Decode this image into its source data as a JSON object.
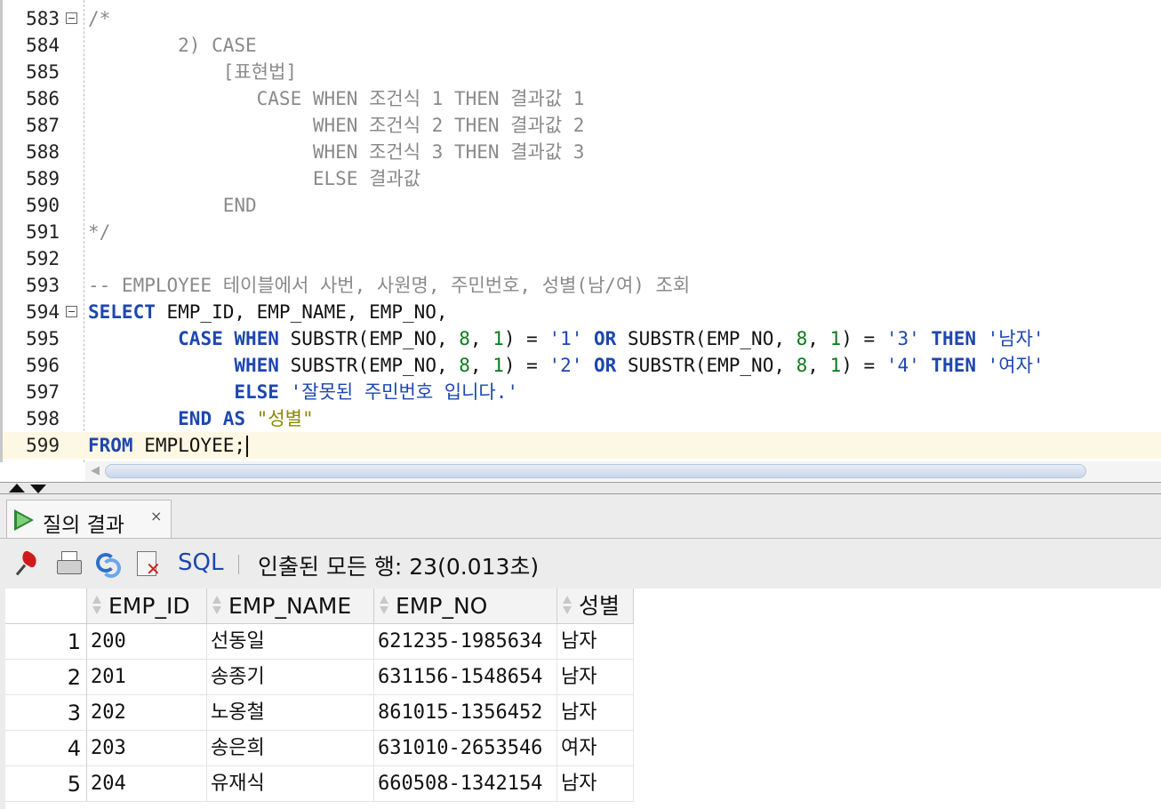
{
  "editor": {
    "lines": [
      {
        "num": "583",
        "fold": true,
        "segments": [
          {
            "t": "/*",
            "c": "com"
          }
        ]
      },
      {
        "num": "584",
        "segments": [
          {
            "t": "        2) CASE",
            "c": "com"
          }
        ]
      },
      {
        "num": "585",
        "segments": [
          {
            "t": "            [표현법]",
            "c": "com"
          }
        ]
      },
      {
        "num": "586",
        "segments": [
          {
            "t": "               CASE WHEN 조건식 1 THEN 결과값 1",
            "c": "com"
          }
        ]
      },
      {
        "num": "587",
        "segments": [
          {
            "t": "                    WHEN 조건식 2 THEN 결과값 2",
            "c": "com"
          }
        ]
      },
      {
        "num": "588",
        "segments": [
          {
            "t": "                    WHEN 조건식 3 THEN 결과값 3",
            "c": "com"
          }
        ]
      },
      {
        "num": "589",
        "segments": [
          {
            "t": "                    ELSE 결과값",
            "c": "com"
          }
        ]
      },
      {
        "num": "590",
        "segments": [
          {
            "t": "            END",
            "c": "com"
          }
        ]
      },
      {
        "num": "591",
        "segments": [
          {
            "t": "*/",
            "c": "com"
          }
        ]
      },
      {
        "num": "592",
        "segments": []
      },
      {
        "num": "593",
        "segments": [
          {
            "t": "-- EMPLOYEE 테이블에서 사번, 사원명, 주민번호, 성별(남/여) 조회",
            "c": "com"
          }
        ]
      },
      {
        "num": "594",
        "fold": true,
        "segments": [
          {
            "t": "SELECT",
            "c": "kw"
          },
          {
            "t": " EMP_ID, EMP_NAME, EMP_NO,",
            "c": "id"
          }
        ]
      },
      {
        "num": "595",
        "segments": [
          {
            "t": "        ",
            "c": "id"
          },
          {
            "t": "CASE WHEN",
            "c": "kw"
          },
          {
            "t": " SUBSTR(EMP_NO, ",
            "c": "id"
          },
          {
            "t": "8",
            "c": "num"
          },
          {
            "t": ", ",
            "c": "id"
          },
          {
            "t": "1",
            "c": "num"
          },
          {
            "t": ") = ",
            "c": "id"
          },
          {
            "t": "'1'",
            "c": "str"
          },
          {
            "t": " ",
            "c": "id"
          },
          {
            "t": "OR",
            "c": "kw"
          },
          {
            "t": " SUBSTR(EMP_NO, ",
            "c": "id"
          },
          {
            "t": "8",
            "c": "num"
          },
          {
            "t": ", ",
            "c": "id"
          },
          {
            "t": "1",
            "c": "num"
          },
          {
            "t": ") = ",
            "c": "id"
          },
          {
            "t": "'3'",
            "c": "str"
          },
          {
            "t": " ",
            "c": "id"
          },
          {
            "t": "THEN",
            "c": "kw"
          },
          {
            "t": " ",
            "c": "id"
          },
          {
            "t": "'남자'",
            "c": "str"
          }
        ]
      },
      {
        "num": "596",
        "segments": [
          {
            "t": "             ",
            "c": "id"
          },
          {
            "t": "WHEN",
            "c": "kw"
          },
          {
            "t": " SUBSTR(EMP_NO, ",
            "c": "id"
          },
          {
            "t": "8",
            "c": "num"
          },
          {
            "t": ", ",
            "c": "id"
          },
          {
            "t": "1",
            "c": "num"
          },
          {
            "t": ") = ",
            "c": "id"
          },
          {
            "t": "'2'",
            "c": "str"
          },
          {
            "t": " ",
            "c": "id"
          },
          {
            "t": "OR",
            "c": "kw"
          },
          {
            "t": " SUBSTR(EMP_NO, ",
            "c": "id"
          },
          {
            "t": "8",
            "c": "num"
          },
          {
            "t": ", ",
            "c": "id"
          },
          {
            "t": "1",
            "c": "num"
          },
          {
            "t": ") = ",
            "c": "id"
          },
          {
            "t": "'4'",
            "c": "str"
          },
          {
            "t": " ",
            "c": "id"
          },
          {
            "t": "THEN",
            "c": "kw"
          },
          {
            "t": " ",
            "c": "id"
          },
          {
            "t": "'여자'",
            "c": "str"
          }
        ]
      },
      {
        "num": "597",
        "segments": [
          {
            "t": "             ",
            "c": "id"
          },
          {
            "t": "ELSE",
            "c": "kw"
          },
          {
            "t": " ",
            "c": "id"
          },
          {
            "t": "'잘못된 주민번호 입니다.'",
            "c": "str"
          }
        ]
      },
      {
        "num": "598",
        "segments": [
          {
            "t": "        ",
            "c": "id"
          },
          {
            "t": "END AS",
            "c": "kw"
          },
          {
            "t": " ",
            "c": "id"
          },
          {
            "t": "\"성별\"",
            "c": "qid"
          }
        ]
      },
      {
        "num": "599",
        "current": true,
        "caret": true,
        "segments": [
          {
            "t": "FROM",
            "c": "kw"
          },
          {
            "t": " EMPLOYEE;",
            "c": "id"
          }
        ]
      }
    ]
  },
  "results": {
    "tab_label": "질의 결과",
    "tab_close": "×",
    "toolbar": {
      "icons": [
        "pin-icon",
        "print-icon",
        "refresh-icon",
        "export-icon"
      ],
      "sql_label": "SQL",
      "status": "인출된 모든 행: 23(0.013초)"
    },
    "grid": {
      "columns": [
        "EMP_ID",
        "EMP_NAME",
        "EMP_NO",
        "성별"
      ],
      "rows": [
        {
          "n": "1",
          "cells": [
            "200",
            "선동일",
            "621235-1985634",
            "남자"
          ]
        },
        {
          "n": "2",
          "cells": [
            "201",
            "송종기",
            "631156-1548654",
            "남자"
          ]
        },
        {
          "n": "3",
          "cells": [
            "202",
            "노옹철",
            "861015-1356452",
            "남자"
          ]
        },
        {
          "n": "4",
          "cells": [
            "203",
            "송은희",
            "631010-2653546",
            "여자"
          ]
        },
        {
          "n": "5",
          "cells": [
            "204",
            "유재식",
            "660508-1342154",
            "남자"
          ]
        }
      ]
    }
  }
}
